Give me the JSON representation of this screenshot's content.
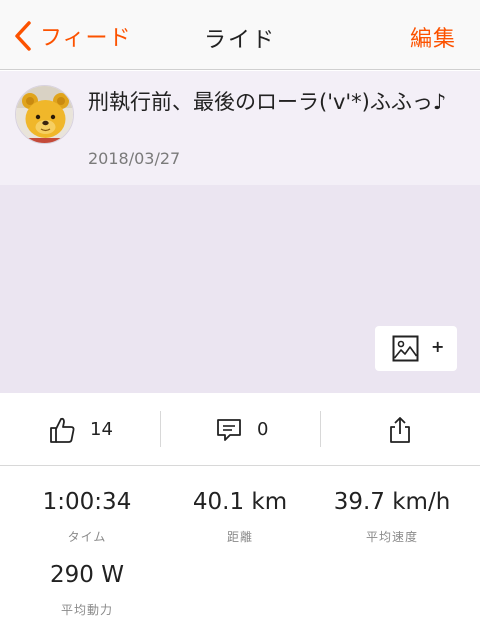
{
  "nav": {
    "back_label": "フィード",
    "title": "ライド",
    "edit_label": "編集"
  },
  "activity": {
    "title": "刑執行前、最後のローラ('v'*)ふふっ♪",
    "date": "2018/03/27"
  },
  "media": {
    "add_photo_plus": "+"
  },
  "actions": {
    "kudos_count": "14",
    "comments_count": "0"
  },
  "stats": [
    {
      "value": "1:00:34",
      "label": "タイム"
    },
    {
      "value": "40.1 km",
      "label": "距離"
    },
    {
      "value": "39.7 km/h",
      "label": "平均速度"
    },
    {
      "value": "290 W",
      "label": "平均動力"
    }
  ],
  "colors": {
    "accent": "#fc5200",
    "header_bg": "#f3eff7",
    "media_bg": "#ebe5f1"
  },
  "icons": {
    "back": "chevron-left-icon",
    "avatar": "bear-plush-avatar",
    "add_photo": "image-icon",
    "kudos": "thumbs-up-icon",
    "comment": "comment-icon",
    "share": "share-icon"
  }
}
